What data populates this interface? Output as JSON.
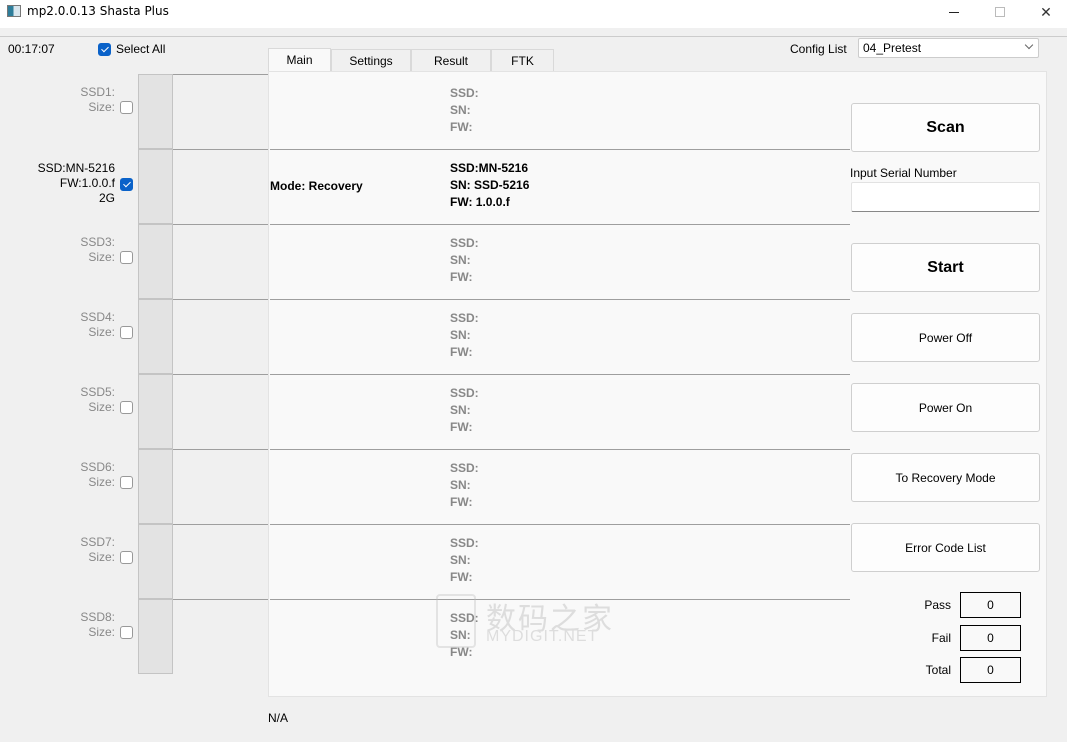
{
  "window": {
    "title": "mp2.0.0.13 Shasta Plus",
    "icon": "app-window-icon",
    "controls": [
      "minimize",
      "maximize",
      "close"
    ]
  },
  "header": {
    "elapsed_time": "00:17:07",
    "select_all_label": "Select All",
    "select_all_checked": true,
    "config_list_label": "Config List",
    "config_list_value": "04_Pretest"
  },
  "tabs": [
    {
      "label": "Main",
      "active": true
    },
    {
      "label": "Settings",
      "active": false
    },
    {
      "label": "Result",
      "active": false
    },
    {
      "label": "FTK",
      "active": false
    }
  ],
  "slots": [
    {
      "line1": "SSD1:",
      "line2": "Size:",
      "line3": "",
      "checked": false,
      "active": false,
      "mode": "",
      "ssd": "SSD:",
      "sn": "SN:",
      "fw": "FW:"
    },
    {
      "line1": "SSD:MN-5216",
      "line2": "FW:1.0.0.f",
      "line3": "2G",
      "checked": true,
      "active": true,
      "mode": "Mode: Recovery",
      "ssd": "SSD:MN-5216",
      "sn": "SN: SSD-5216",
      "fw": "FW: 1.0.0.f"
    },
    {
      "line1": "SSD3:",
      "line2": "Size:",
      "line3": "",
      "checked": false,
      "active": false,
      "mode": "",
      "ssd": "SSD:",
      "sn": "SN:",
      "fw": "FW:"
    },
    {
      "line1": "SSD4:",
      "line2": "Size:",
      "line3": "",
      "checked": false,
      "active": false,
      "mode": "",
      "ssd": "SSD:",
      "sn": "SN:",
      "fw": "FW:"
    },
    {
      "line1": "SSD5:",
      "line2": "Size:",
      "line3": "",
      "checked": false,
      "active": false,
      "mode": "",
      "ssd": "SSD:",
      "sn": "SN:",
      "fw": "FW:"
    },
    {
      "line1": "SSD6:",
      "line2": "Size:",
      "line3": "",
      "checked": false,
      "active": false,
      "mode": "",
      "ssd": "SSD:",
      "sn": "SN:",
      "fw": "FW:"
    },
    {
      "line1": "SSD7:",
      "line2": "Size:",
      "line3": "",
      "checked": false,
      "active": false,
      "mode": "",
      "ssd": "SSD:",
      "sn": "SN:",
      "fw": "FW:"
    },
    {
      "line1": "SSD8:",
      "line2": "Size:",
      "line3": "",
      "checked": false,
      "active": false,
      "mode": "",
      "ssd": "SSD:",
      "sn": "SN:",
      "fw": "FW:"
    }
  ],
  "actions": {
    "scan": "Scan",
    "serial_label": "Input Serial Number",
    "serial_value": "",
    "start": "Start",
    "power_off": "Power Off",
    "power_on": "Power On",
    "to_recovery": "To Recovery Mode",
    "error_codes": "Error Code List"
  },
  "stats": {
    "pass_label": "Pass",
    "pass": "0",
    "fail_label": "Fail",
    "fail": "0",
    "total_label": "Total",
    "total": "0"
  },
  "status_text": "N/A",
  "watermark": {
    "cn": "数码之家",
    "en": "MYDIGIT.NET"
  }
}
